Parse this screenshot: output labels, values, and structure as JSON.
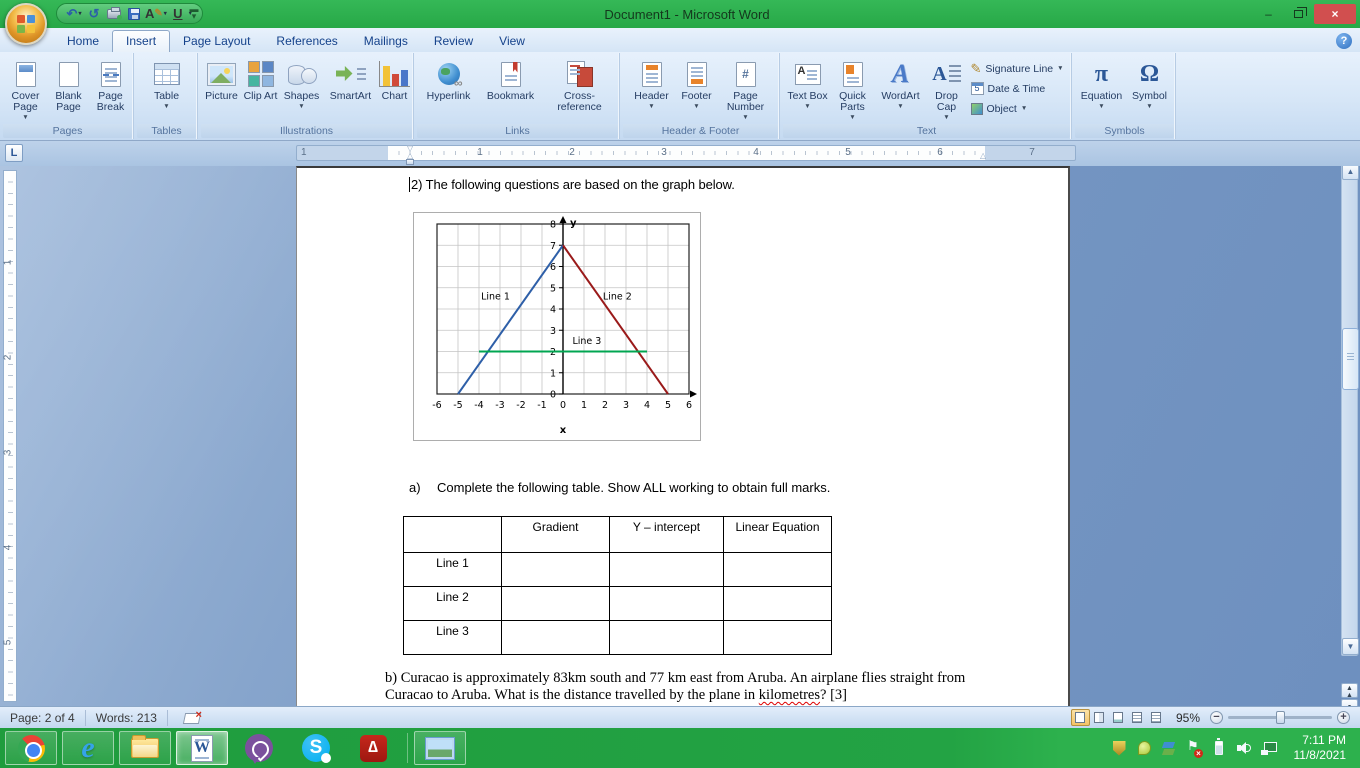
{
  "window": {
    "title": "Document1 - Microsoft Word",
    "controls": {
      "minimize": "–",
      "restore": "restore",
      "close": "×"
    }
  },
  "icons": {
    "undo": "↶",
    "redo": "↺",
    "font_style": "A",
    "underline": "U",
    "dropdown": "▾",
    "help": "?",
    "tab_selector": "L",
    "pi": "π",
    "omega": "Ω",
    "acrobat_glyph": "∆",
    "skype_glyph": "S",
    "ie_glyph": "e",
    "word_glyph": "W",
    "hash": "#",
    "scroll_up": "▲",
    "scroll_down": "▼",
    "browse_prev": "▲▲",
    "browse_obj": "●",
    "browse_next": "▼▼",
    "zoom_out": "−",
    "zoom_in": "+"
  },
  "colors": {
    "title_green": "#2cb14b",
    "taskbar_green": "#23a344",
    "accent_blue": "#15428b",
    "close_red": "#d14f4f",
    "line1": "#2e5fa8",
    "line2": "#9a1a1a",
    "line3": "#00a651"
  },
  "tabs": [
    "Home",
    "Insert",
    "Page Layout",
    "References",
    "Mailings",
    "Review",
    "View"
  ],
  "active_tab": "Insert",
  "ribbon": {
    "pages": {
      "name": "Pages",
      "cover": "Cover Page",
      "blank": "Blank Page",
      "brk": "Page Break"
    },
    "tables": {
      "name": "Tables",
      "table": "Table"
    },
    "illustrations": {
      "name": "Illustrations",
      "picture": "Picture",
      "clipart": "Clip Art",
      "shapes": "Shapes",
      "smartart": "SmartArt",
      "chart": "Chart"
    },
    "links": {
      "name": "Links",
      "hyperlink": "Hyperlink",
      "bookmark": "Bookmark",
      "crossref": "Cross-reference"
    },
    "headerfooter": {
      "name": "Header & Footer",
      "header": "Header",
      "footer": "Footer",
      "pagenum": "Page Number"
    },
    "text": {
      "name": "Text",
      "textbox": "Text Box",
      "quickparts": "Quick Parts",
      "wordart": "WordArt",
      "dropcap": "Drop Cap",
      "sigline": "Signature Line",
      "datetime": "Date & Time",
      "object": "Object"
    },
    "symbols": {
      "name": "Symbols",
      "equation": "Equation",
      "symbol": "Symbol"
    }
  },
  "ruler": {
    "h_labels": [
      "1",
      "1",
      "2",
      "3",
      "4",
      "5",
      "6",
      "7"
    ],
    "v_labels": [
      "1",
      "2",
      "3",
      "4",
      "5"
    ]
  },
  "document": {
    "q2": "2) The following questions are based on the graph below.",
    "qa_marker": "a)",
    "qa_text": "Complete the following table. Show ALL working to obtain full marks.",
    "table": {
      "headers": [
        "",
        "Gradient",
        "Y – intercept",
        "Linear Equation"
      ],
      "rows": [
        "Line 1",
        "Line 2",
        "Line 3"
      ]
    },
    "qb_line1": "b) Curacao is approximately 83km south and 77 km east from Aruba. An airplane flies straight from",
    "qb_line2_pre": "Curacao to Aruba. What is the distance travelled by the plane in ",
    "qb_misspelled": "kilometres",
    "qb_line2_post": "? [3]"
  },
  "chart_data": {
    "type": "line",
    "title": "",
    "xlabel": "x",
    "ylabel": "y",
    "xlim": [
      -6,
      6
    ],
    "ylim": [
      0,
      8
    ],
    "x_ticks": [
      -6,
      -5,
      -4,
      -3,
      -2,
      -1,
      0,
      1,
      2,
      3,
      4,
      5,
      6
    ],
    "y_ticks": [
      0,
      1,
      2,
      3,
      4,
      5,
      6,
      7,
      8
    ],
    "grid": true,
    "legend_position": "inline-annotations",
    "series": [
      {
        "name": "Line 1",
        "color": "#2e5fa8",
        "points": [
          [
            -5,
            0
          ],
          [
            0,
            7
          ]
        ]
      },
      {
        "name": "Line 2",
        "color": "#9a1a1a",
        "points": [
          [
            0,
            7
          ],
          [
            5,
            0
          ]
        ]
      },
      {
        "name": "Line 3",
        "color": "#00a651",
        "points": [
          [
            -4,
            2
          ],
          [
            4,
            2
          ]
        ]
      }
    ],
    "annotations": [
      {
        "text": "Line 1",
        "x": -3.9,
        "y": 4.45
      },
      {
        "text": "Line 2",
        "x": 1.9,
        "y": 4.45
      },
      {
        "text": "Line 3",
        "x": 0.45,
        "y": 2.35
      }
    ]
  },
  "statusbar": {
    "page": "Page: 2 of 4",
    "words": "Words: 213",
    "zoom": "95%"
  },
  "taskbar": {
    "apps": [
      "chrome",
      "internet-explorer",
      "file-explorer",
      "word",
      "viber",
      "skype",
      "acrobat",
      "photos"
    ],
    "active_app": "word",
    "tray_icons": [
      "antivirus-shield",
      "lime",
      "bluestacks",
      "action-center-flag",
      "battery",
      "volume",
      "network"
    ],
    "time": "7:11 PM",
    "date": "11/8/2021"
  }
}
